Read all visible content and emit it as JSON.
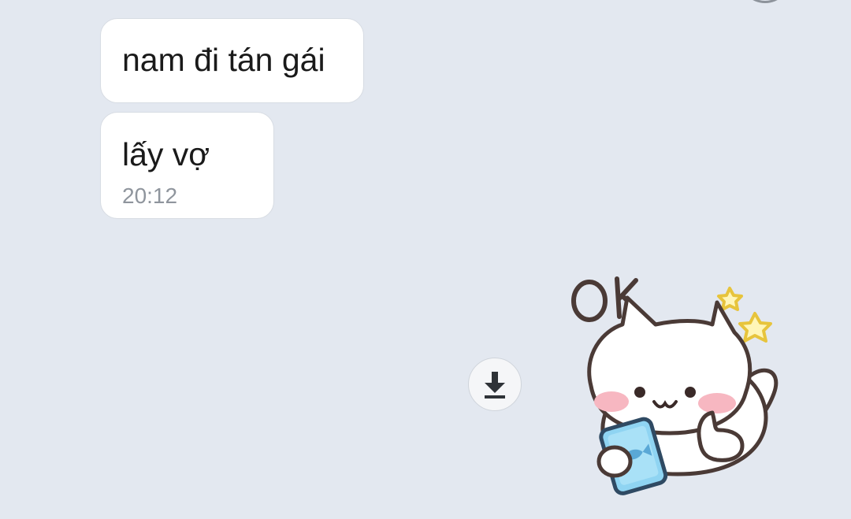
{
  "messages": [
    {
      "text": "nam đi tán gái"
    },
    {
      "text": "lấy vợ",
      "time": "20:12"
    }
  ],
  "sticker": {
    "caption": "OK",
    "description": "white cat lying down holding a blue phone, thumbs up"
  },
  "icons": {
    "download": "download-icon"
  },
  "colors": {
    "background": "#e3e8f0",
    "bubble": "#ffffff",
    "time": "#8f959d",
    "text": "#1a1a1a"
  }
}
